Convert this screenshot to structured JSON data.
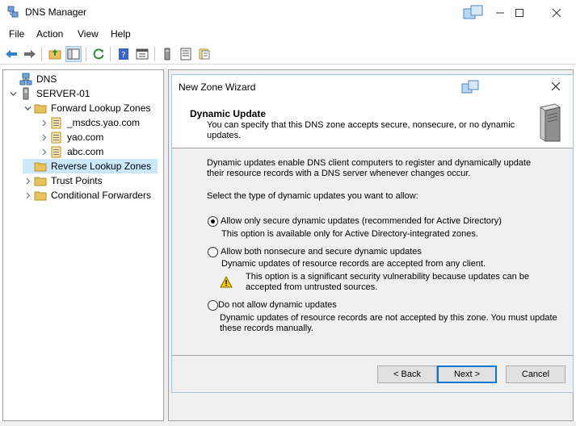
{
  "window": {
    "title": "DNS Manager"
  },
  "menu": [
    "File",
    "Action",
    "View",
    "Help"
  ],
  "tree": {
    "items": [
      {
        "label": "DNS",
        "expander": "",
        "icon": "dns-icon"
      },
      {
        "label": "SERVER-01",
        "expander": "expanded",
        "icon": "server-icon"
      },
      {
        "label": "Forward Lookup Zones",
        "expander": "expanded",
        "icon": "folder-icon"
      },
      {
        "label": "_msdcs.yao.com",
        "expander": "collapsed",
        "icon": "zone-icon"
      },
      {
        "label": "yao.com",
        "expander": "collapsed",
        "icon": "zone-icon"
      },
      {
        "label": "abc.com",
        "expander": "collapsed",
        "icon": "zone-icon"
      },
      {
        "label": "Reverse Lookup Zones",
        "expander": "",
        "icon": "folder-icon",
        "selected": true
      },
      {
        "label": "Trust Points",
        "expander": "collapsed",
        "icon": "folder-icon"
      },
      {
        "label": "Conditional Forwarders",
        "expander": "collapsed",
        "icon": "folder-icon"
      }
    ]
  },
  "wizard": {
    "title": "New Zone Wizard",
    "header_title": "Dynamic Update",
    "header_subtitle": "You can specify that this DNS zone accepts secure, nonsecure, or no dynamic updates.",
    "intro": "Dynamic updates enable DNS client computers to register and dynamically update their resource records with a DNS server whenever changes occur.",
    "prompt": "Select the type of dynamic updates you want to allow:",
    "options": [
      {
        "label": "Allow only secure dynamic updates (recommended for Active Directory)",
        "desc": "This option is available only for Active Directory-integrated zones.",
        "selected": true
      },
      {
        "label": "Allow both nonsecure and secure dynamic updates",
        "desc": "Dynamic updates of resource records are accepted from any client.",
        "warning": "This option is a significant security vulnerability because updates can be accepted from untrusted sources.",
        "selected": false
      },
      {
        "label": "Do not allow dynamic updates",
        "desc": "Dynamic updates of resource records are not accepted by this zone. You must update these records manually.",
        "selected": false
      }
    ],
    "buttons": {
      "back": "< Back",
      "next": "Next >",
      "cancel": "Cancel"
    }
  },
  "colors": {
    "selection": "#cce8ff",
    "accent": "#0078d7",
    "folder": "#e8c35a"
  }
}
